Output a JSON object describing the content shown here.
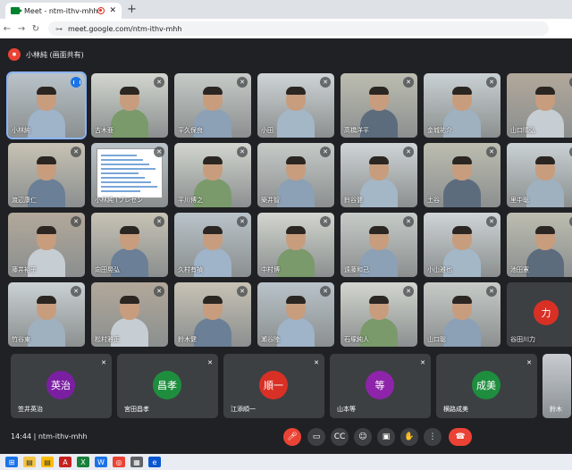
{
  "browser": {
    "tab_title": "Meet - ntm-ithv-mhh",
    "new_tab": "+",
    "url": "meet.google.com/ntm-ithv-mhh"
  },
  "presenting": {
    "label": "小林純 (画面共有)"
  },
  "participants": [
    {
      "name": "小林純",
      "row": 0
    },
    {
      "name": "古木亜",
      "row": 0
    },
    {
      "name": "平久保良",
      "row": 0
    },
    {
      "name": "小田",
      "row": 0
    },
    {
      "name": "高橋洋平",
      "row": 0
    },
    {
      "name": "金城祐介",
      "row": 0
    },
    {
      "name": "山口晴弘",
      "row": 0
    },
    {
      "name": "渡辺康仁",
      "row": 1
    },
    {
      "name": "小林純 (プレゼン",
      "row": 1
    },
    {
      "name": "平川博之",
      "row": 1
    },
    {
      "name": "築井智",
      "row": 1
    },
    {
      "name": "鈴谷健",
      "row": 1
    },
    {
      "name": "土谷",
      "row": 1
    },
    {
      "name": "里中聡",
      "row": 1
    },
    {
      "name": "藤井裕子",
      "row": 2
    },
    {
      "name": "向田晃弘",
      "row": 2
    },
    {
      "name": "久村有禎",
      "row": 2
    },
    {
      "name": "中村博",
      "row": 2
    },
    {
      "name": "遠藤和己",
      "row": 2
    },
    {
      "name": "小山雅也",
      "row": 2
    },
    {
      "name": "池田憲",
      "row": 2
    },
    {
      "name": "竹谷東",
      "row": 3
    },
    {
      "name": "松村雅正",
      "row": 3
    },
    {
      "name": "鈴木健",
      "row": 3
    },
    {
      "name": "瀬谷陸",
      "row": 3
    },
    {
      "name": "石塚純人",
      "row": 3
    },
    {
      "name": "山口聡",
      "row": 3
    },
    {
      "name": "谷田川力",
      "row": 3,
      "avatar": "力",
      "avatar_color": "#d93025"
    }
  ],
  "avatar_cards": [
    {
      "name": "笠井英治",
      "initials": "英治",
      "color": "#7b1fa2"
    },
    {
      "name": "宮田昌孝",
      "initials": "昌孝",
      "color": "#1e8e3e"
    },
    {
      "name": "江添順一",
      "initials": "順一",
      "color": "#d93025"
    },
    {
      "name": "山本等",
      "initials": "等",
      "color": "#8e24aa"
    },
    {
      "name": "横路成美",
      "initials": "成美",
      "color": "#1e8e3e"
    },
    {
      "name": "鈴木",
      "initials": "",
      "color": "#5f6368"
    }
  ],
  "meeting": {
    "time": "14:44",
    "separator": "|",
    "code": "ntm-ithv-mhh"
  },
  "icons": [
    "mic-off-icon",
    "camera-icon",
    "captions-icon",
    "emoji-icon",
    "present-icon",
    "hand-icon",
    "more-icon",
    "hangup-icon"
  ],
  "colors": {
    "meet_bg": "#202124",
    "tile_bg": "#3c4043",
    "danger": "#ea4335"
  }
}
